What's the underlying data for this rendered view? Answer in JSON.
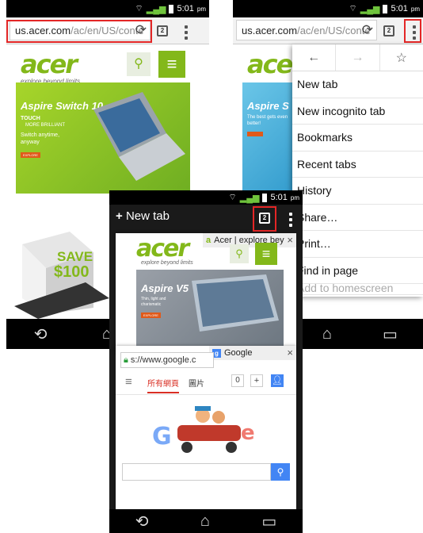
{
  "status": {
    "time": "5:01",
    "ampm": "pm"
  },
  "left": {
    "url_host": "us.acer.com",
    "url_path": "/ac/en/US/conte",
    "tab_count": "2",
    "logo": "acer",
    "tagline": "explore beyond limits",
    "promo_title": "Aspire Switch 10",
    "promo_touch": "TOUCH",
    "promo_brilliant": "MORE BRILLIANT",
    "promo_sub": "Switch anytime, anyway",
    "promo_btn": "EXPLORE",
    "save_line1": "SAVE",
    "save_line2": "$100"
  },
  "right": {
    "url_host": "us.acer.com",
    "url_path": "/ac/en/US/conte",
    "tab_count": "2",
    "promo_title": "Aspire S",
    "promo_sub": "The best gets even better!",
    "menu_items": [
      "New tab",
      "New incognito tab",
      "Bookmarks",
      "Recent tabs",
      "History",
      "Share…",
      "Print…",
      "Find in page",
      "Add to homescreen"
    ]
  },
  "center": {
    "new_tab_label": "New tab",
    "tab_count": "2",
    "card1_title": "Acer | explore bey",
    "card1_logo": "acer",
    "card1_tagline": "explore beyond limits",
    "card1_promo_title": "Aspire V5",
    "card1_promo_sub": "Thin, light and charismatic",
    "card1_btn": "EXPLORE",
    "card2_title": "Google",
    "card2_url": "s://www.google.c",
    "google_tab_all": "所有網頁",
    "google_tab_images": "圖片",
    "google_count": "0",
    "google_plus": "+",
    "close_glyph": "×"
  },
  "colors": {
    "acer_green": "#83b81a",
    "highlight_red": "#e32626"
  }
}
